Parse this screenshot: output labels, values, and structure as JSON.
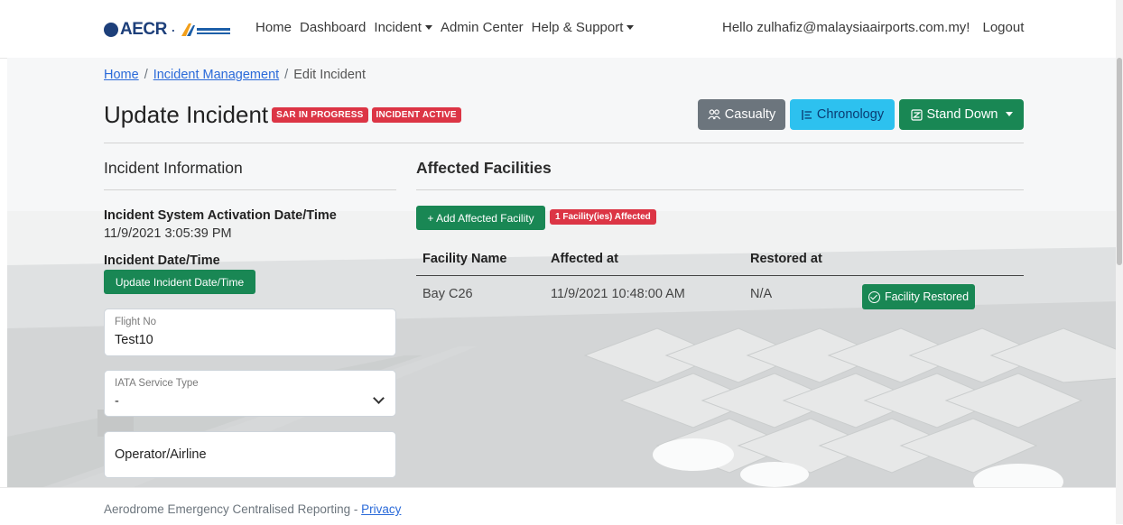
{
  "nav": {
    "brand": "AECR",
    "brand_sep": "·",
    "links": [
      {
        "label": "Home",
        "has_caret": false
      },
      {
        "label": "Dashboard",
        "has_caret": false
      },
      {
        "label": "Incident",
        "has_caret": true
      },
      {
        "label": "Admin Center",
        "has_caret": false
      },
      {
        "label": "Help & Support",
        "has_caret": true
      }
    ],
    "greeting": "Hello zulhafiz@malaysiaairports.com.my!",
    "logout": "Logout"
  },
  "breadcrumb": {
    "home": "Home",
    "incident_mgmt": "Incident Management",
    "current": "Edit Incident",
    "separator": "/"
  },
  "header": {
    "title": "Update Incident",
    "badges": [
      "SAR IN PROGRESS",
      "INCIDENT ACTIVE"
    ]
  },
  "actions": {
    "casualty": "Casualty",
    "chronology": "Chronology",
    "stand_down": "Stand Down"
  },
  "incident_info": {
    "section_title": "Incident Information",
    "activation_label": "Incident System Activation Date/Time",
    "activation_value": "11/9/2021 3:05:39 PM",
    "incident_dt_label": "Incident Date/Time",
    "update_dt_button": "Update Incident Date/Time",
    "flight_no_label": "Flight No",
    "flight_no_value": "Test10",
    "iata_label": "IATA Service Type",
    "iata_value": "-",
    "operator_placeholder": "Operator/Airline"
  },
  "facilities": {
    "section_title": "Affected Facilities",
    "add_button": "+ Add Affected Facility",
    "count_badge": "1 Facility(ies) Affected",
    "columns": [
      "Facility Name",
      "Affected at",
      "Restored at"
    ],
    "rows": [
      {
        "name": "Bay C26",
        "affected_at": "11/9/2021 10:48:00 AM",
        "restored_at": "N/A",
        "action": "Facility Restored"
      }
    ]
  },
  "footer": {
    "text": "Aerodrome Emergency Centralised Reporting - ",
    "privacy": "Privacy"
  },
  "colors": {
    "primary_green": "#198754",
    "danger_red": "#dc3545",
    "info_cyan": "#2dc1ef",
    "secondary_gray": "#6c757d",
    "brand_blue": "#1d3f7a"
  }
}
